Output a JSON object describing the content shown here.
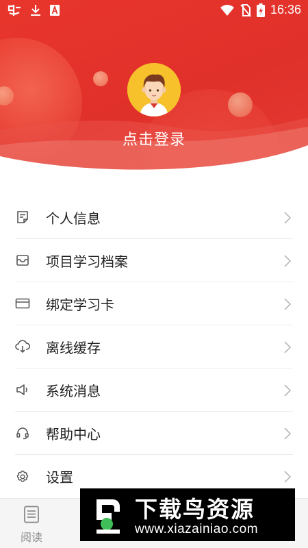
{
  "status_bar": {
    "time": "16:36",
    "left_icons": [
      "app-notification-icon",
      "download-icon",
      "a-box-icon"
    ],
    "right_icons": [
      "wifi-icon",
      "no-sim-icon",
      "battery-charging-icon"
    ]
  },
  "header": {
    "login_text": "点击登录",
    "accent_color": "#e4322b"
  },
  "menu": {
    "items": [
      {
        "label": "个人信息",
        "icon": "document-icon"
      },
      {
        "label": "项目学习档案",
        "icon": "inbox-icon"
      },
      {
        "label": "绑定学习卡",
        "icon": "card-icon"
      },
      {
        "label": "离线缓存",
        "icon": "cloud-download-icon"
      },
      {
        "label": "系统消息",
        "icon": "speaker-icon"
      },
      {
        "label": "帮助中心",
        "icon": "headset-icon"
      },
      {
        "label": "设置",
        "icon": "gear-icon"
      }
    ]
  },
  "tabbar": {
    "tabs": [
      {
        "label": "阅读",
        "icon": "book-icon"
      }
    ]
  },
  "watermark": {
    "title": "下载鸟资源",
    "url": "www.xiazainiao.com"
  }
}
